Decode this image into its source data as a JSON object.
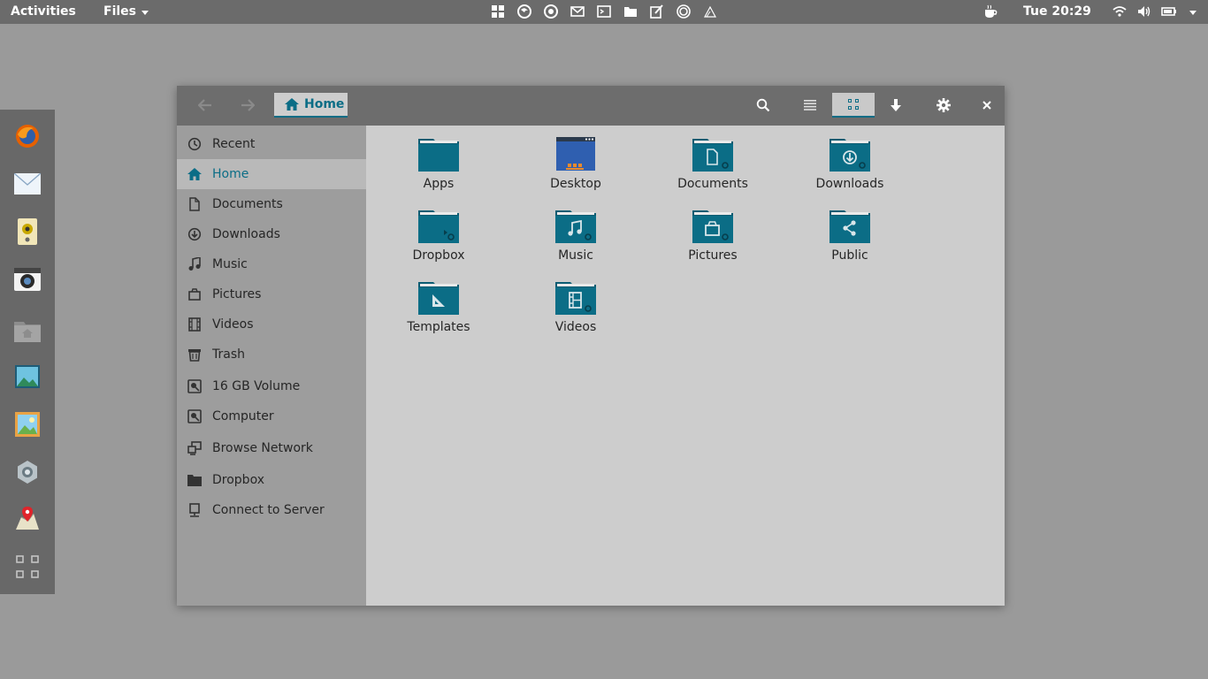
{
  "topbar": {
    "activities": "Activities",
    "app_menu": "Files",
    "clock": "Tue 20:29",
    "app_icons": [
      "grid-icon",
      "firefox-icon",
      "chrome-icon",
      "mail-icon",
      "terminal-icon",
      "folder-icon",
      "editor-icon",
      "disc-icon",
      "inkscape-icon"
    ],
    "status_icons": [
      "coffee-icon",
      "wifi-icon",
      "volume-icon",
      "battery-icon",
      "chevron-down-icon"
    ]
  },
  "dock": {
    "items": [
      "firefox",
      "mail",
      "speaker",
      "camera",
      "home-folder",
      "image-viewer",
      "photos",
      "settings",
      "maps",
      "show-apps"
    ]
  },
  "window": {
    "path": {
      "label": "Home"
    },
    "accent": "#0b6d86",
    "view": "grid"
  },
  "sidebar": {
    "items": [
      {
        "label": "Recent",
        "icon": "clock"
      },
      {
        "label": "Home",
        "icon": "home",
        "selected": true
      },
      {
        "label": "Documents",
        "icon": "document"
      },
      {
        "label": "Downloads",
        "icon": "download"
      },
      {
        "label": "Music",
        "icon": "music"
      },
      {
        "label": "Pictures",
        "icon": "pictures"
      },
      {
        "label": "Videos",
        "icon": "film"
      },
      {
        "label": "Trash",
        "icon": "trash"
      },
      {
        "label": "16 GB Volume",
        "icon": "drive"
      },
      {
        "label": "Computer",
        "icon": "drive"
      },
      {
        "label": "Browse Network",
        "icon": "network"
      },
      {
        "label": "Dropbox",
        "icon": "folder"
      },
      {
        "label": "Connect to Server",
        "icon": "server"
      }
    ]
  },
  "content": {
    "items": [
      {
        "label": "Apps",
        "icon": "folder"
      },
      {
        "label": "Desktop",
        "icon": "desktop"
      },
      {
        "label": "Documents",
        "icon": "folder-documents"
      },
      {
        "label": "Downloads",
        "icon": "folder-downloads"
      },
      {
        "label": "Dropbox",
        "icon": "folder-dropbox"
      },
      {
        "label": "Music",
        "icon": "folder-music"
      },
      {
        "label": "Pictures",
        "icon": "folder-pictures"
      },
      {
        "label": "Public",
        "icon": "folder-public"
      },
      {
        "label": "Templates",
        "icon": "folder-templates"
      },
      {
        "label": "Videos",
        "icon": "folder-videos"
      }
    ]
  }
}
